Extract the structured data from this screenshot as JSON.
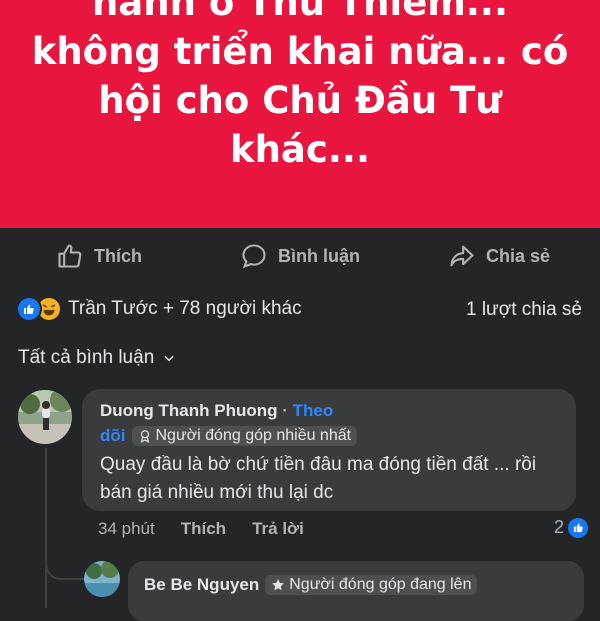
{
  "post": {
    "banner_lines": [
      "hanh ô Thu Thiêm...",
      "không triển khai nữa... có",
      "hội cho Chủ Đầu Tư",
      "khác..."
    ],
    "banner_color": "#e8153f"
  },
  "actions": {
    "like_label": "Thích",
    "comment_label": "Bình luận",
    "share_label": "Chia sẻ"
  },
  "stats": {
    "reactions_text": "Trần Tước + 78 người khác",
    "shares_text": "1 lượt chia sẻ"
  },
  "comments_filter": {
    "label": "Tất cả bình luận"
  },
  "comment": {
    "author": "Duong Thanh Phuong",
    "separator": "·",
    "follow_label_1": "Theo",
    "follow_label_2": "dõi",
    "badge": "Người đóng góp nhiều nhất",
    "text": "Quay đầu là bờ chứ tiền đâu ma đóng tiền đất ... rồi bán giá nhiều mới thu lại dc",
    "time": "34 phút",
    "like_label": "Thích",
    "reply_label": "Trả lời",
    "like_count": "2"
  },
  "reply": {
    "author": "Be Be Nguyen",
    "badge": "Người đóng góp đang lên"
  },
  "colors": {
    "background": "#242526",
    "bubble": "#3a3b3c",
    "link": "#2d88ff",
    "like_blue": "#1877f2"
  }
}
